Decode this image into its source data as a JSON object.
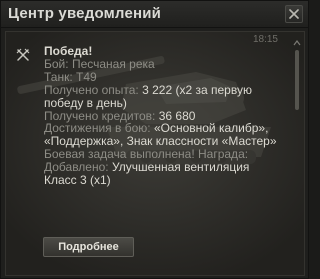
{
  "window": {
    "title": "Центр уведомлений"
  },
  "notification": {
    "time": "18:15",
    "heading": "Победа!",
    "battle_label": "Бой:",
    "battle_value": "Песчаная река",
    "tank_label": "Танк:",
    "tank_value": "T49",
    "xp_label": "Получено опыта:",
    "xp_value": "3 222",
    "xp_note": "(x2 за первую победу в день)",
    "credits_label": "Получено кредитов:",
    "credits_value": "36 680",
    "achievements_label": "Достижения в бою:",
    "achievements_value": "«Основной калибр», «Поддержка», Знак классности «Мастер»",
    "task_text": "Боевая задача выполнена! Награда:",
    "added_label": "Добавлено:",
    "added_value": "Улучшенная вентиляция Класс 3 (x1)",
    "more_button": "Подробнее"
  }
}
